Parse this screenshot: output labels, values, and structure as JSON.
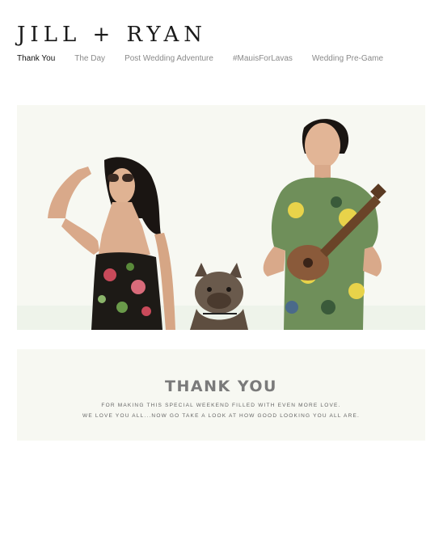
{
  "header": {
    "title": "JILL + RYAN"
  },
  "nav": {
    "items": [
      {
        "label": "Thank You",
        "active": true
      },
      {
        "label": "The Day",
        "active": false
      },
      {
        "label": "Post Wedding Adventure",
        "active": false
      },
      {
        "label": "#MauisForLavas",
        "active": false
      },
      {
        "label": "Wedding Pre-Game",
        "active": false
      }
    ]
  },
  "hero": {
    "image": "couple-photo",
    "background_color": "#f7f8f2"
  },
  "thanks": {
    "title": "THANK YOU",
    "line1": "FOR MAKING THIS SPECIAL WEEKEND FILLED WITH EVEN MORE LOVE.",
    "line2": "WE LOVE YOU ALL...NOW GO TAKE A LOOK AT HOW GOOD LOOKING YOU ALL ARE."
  }
}
